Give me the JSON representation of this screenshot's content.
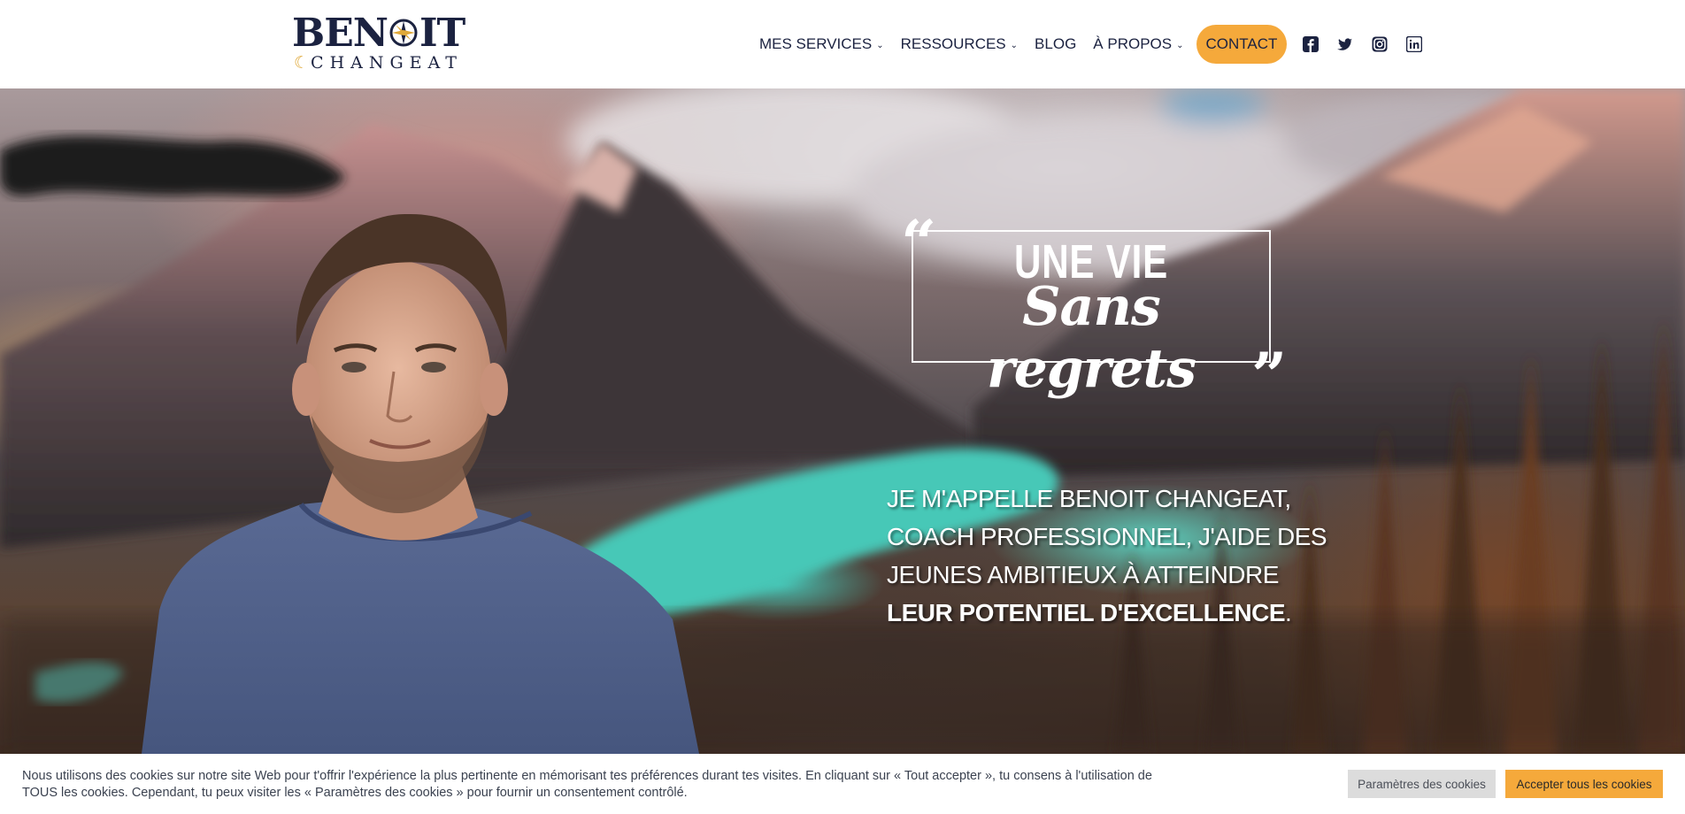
{
  "logo": {
    "top_text_left": "BEN",
    "top_text_right": "IT",
    "bottom_text": "CHANGEAT",
    "icon": "compass-icon"
  },
  "nav": {
    "items": [
      {
        "label": "MES SERVICES",
        "has_dropdown": true
      },
      {
        "label": "RESSOURCES",
        "has_dropdown": true
      },
      {
        "label": "BLOG",
        "has_dropdown": false
      },
      {
        "label": "À PROPOS",
        "has_dropdown": true
      }
    ],
    "contact_label": "CONTACT",
    "social": [
      "facebook-icon",
      "twitter-icon",
      "instagram-icon",
      "linkedin-icon"
    ]
  },
  "hero": {
    "quote_line1": "UNE VIE",
    "quote_line2": "Sans regrets",
    "intro_part1": "JE M'APPELLE BENOIT CHANGEAT, COACH PROFESSIONNEL, J'AIDE DES JEUNES AMBITIEUX À ATTEINDRE ",
    "intro_bold": "LEUR POTENTIEL D'EXCELLENCE",
    "intro_end": "."
  },
  "cookie": {
    "text": "Nous utilisons des cookies sur notre site Web pour t'offrir l'expérience la plus pertinente en mémorisant tes préférences durant tes visites. En cliquant sur « Tout accepter », tu consens à l'utilisation de TOUS les cookies. Cependant, tu peux visiter les « Paramètres des cookies » pour fournir un consentement contrôlé.",
    "settings_label": "Paramètres des cookies",
    "accept_label": "Accepter tous les cookies"
  },
  "colors": {
    "accent": "#f5a93b",
    "navy": "#1b2240"
  }
}
